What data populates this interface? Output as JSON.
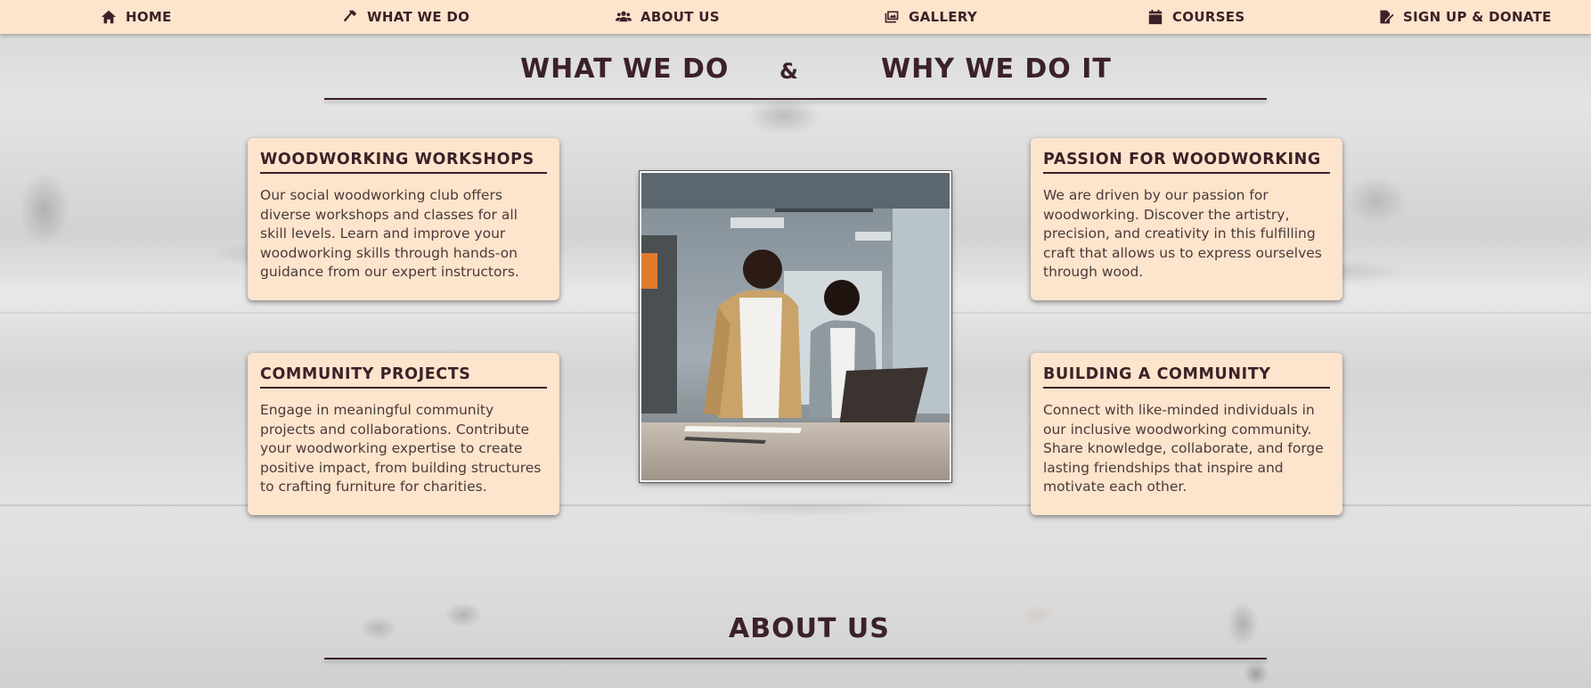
{
  "nav": {
    "items": [
      {
        "label": "HOME",
        "icon": "house-icon"
      },
      {
        "label": "WHAT WE DO",
        "icon": "hammer-icon"
      },
      {
        "label": "ABOUT US",
        "icon": "users-icon"
      },
      {
        "label": "GALLERY",
        "icon": "images-icon"
      },
      {
        "label": "COURSES",
        "icon": "calendar-icon"
      },
      {
        "label": "SIGN UP & DONATE",
        "icon": "signature-icon"
      }
    ]
  },
  "what_we_do": {
    "title_left": "WHAT WE DO",
    "ampersand": "&",
    "title_right": "WHY WE DO IT",
    "cards": [
      {
        "title": "WOODWORKING WORKSHOPS",
        "text": "Our social woodworking club offers diverse workshops and classes for all skill levels. Learn and improve your woodworking skills through hands-on guidance from our expert instructors."
      },
      {
        "title": "PASSION FOR WOODWORKING",
        "text": "We are driven by our passion for woodworking. Discover the artistry, precision, and creativity in this fulfilling craft that allows us to express ourselves through wood."
      },
      {
        "title": "COMMUNITY PROJECTS",
        "text": "Engage in meaningful community projects and collaborations. Contribute your woodworking expertise to create positive impact, from building structures to crafting furniture for charities."
      },
      {
        "title": "BUILDING A COMMUNITY",
        "text": "Connect with like-minded individuals in our inclusive woodworking community. Share knowledge, collaborate, and forge lasting friendships that inspire and motivate each other."
      }
    ]
  },
  "about": {
    "title": "ABOUT US"
  },
  "colors": {
    "nav_bg": "#fde4cc",
    "card_bg": "#fde4cc",
    "text_dark": "#3b2128"
  }
}
